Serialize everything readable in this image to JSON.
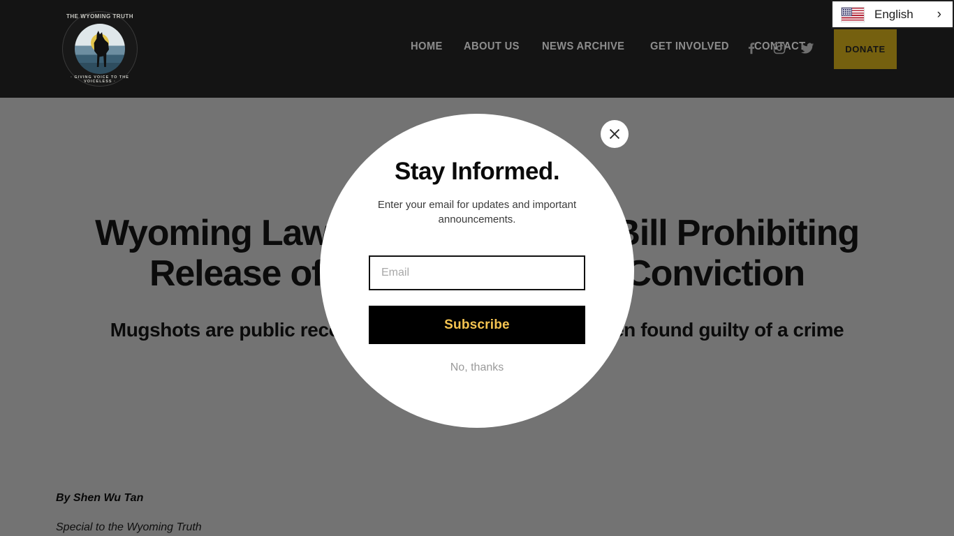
{
  "language_widget": {
    "label": "English",
    "chevron": "›",
    "flag_icon": "us-flag-icon"
  },
  "header": {
    "logo": {
      "text_top": "THE WYOMING TRUTH",
      "text_bottom": "· GIVING VOICE TO THE VOICELESS ·"
    },
    "nav": [
      {
        "label": "HOME"
      },
      {
        "label": "ABOUT US"
      },
      {
        "label": "NEWS ARCHIVE"
      },
      {
        "label": "GET INVOLVED"
      },
      {
        "label": "CONTACT"
      }
    ],
    "socials": [
      {
        "name": "facebook-icon"
      },
      {
        "name": "instagram-icon"
      },
      {
        "name": "twitter-icon"
      }
    ],
    "donate_label": "DONATE",
    "donate_color": "#75600f",
    "background_color": "#141414"
  },
  "article": {
    "headline": "Wyoming Lawmakers Advance Bill Prohibiting Release of Mugshots Before Conviction",
    "subheadline": "Mugshots are public records, even if a person hasn’t been found guilty of a crime",
    "byline_author": "By Shen Wu Tan",
    "byline_source": "Special to the Wyoming Truth"
  },
  "modal": {
    "title": "Stay Informed.",
    "subtitle": "Enter your email for updates and important announcements.",
    "email_placeholder": "Email",
    "email_value": "",
    "subscribe_label": "Subscribe",
    "decline_label": "No, thanks",
    "close_icon": "close-icon",
    "subscribe_text_color": "#f5c451",
    "subscribe_bg_color": "#000000"
  }
}
